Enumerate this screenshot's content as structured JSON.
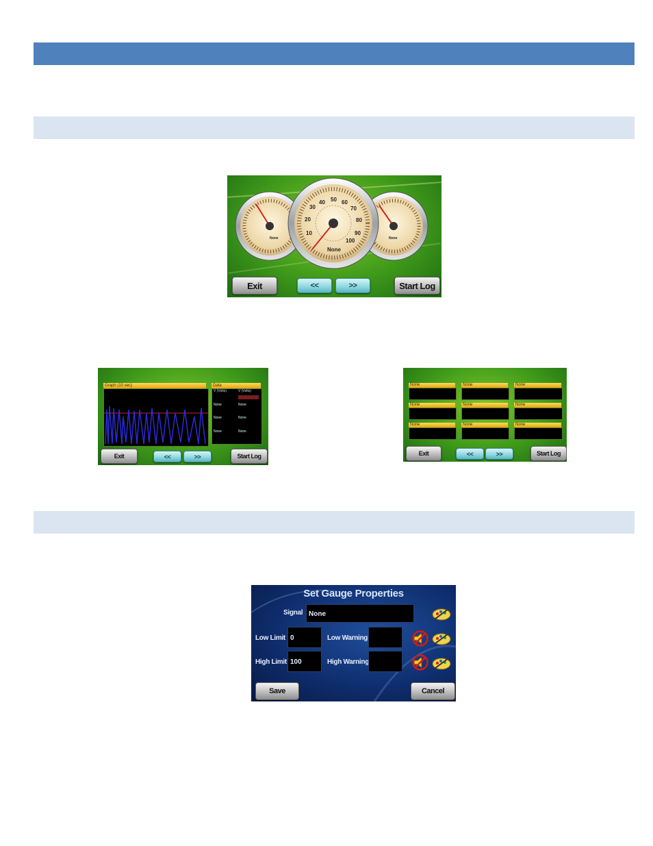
{
  "gauge_screen": {
    "left_gauge_label": "None",
    "center_gauge_ticks": [
      "10",
      "20",
      "30",
      "40",
      "50",
      "60",
      "70",
      "80",
      "90",
      "100"
    ],
    "center_gauge_label": "None",
    "right_gauge_label": "None",
    "buttons": {
      "exit": "Exit",
      "prev": "<<",
      "next": ">>",
      "start_log": "Start Log"
    }
  },
  "graph_screen": {
    "graph_title": "Graph (10 sec)",
    "data_title": "Data",
    "data_header_1": "V (Volts)",
    "data_header_2": "V (Volts)",
    "data_rows": [
      [
        "",
        ""
      ],
      [
        "None",
        "None"
      ],
      [
        "None",
        "None"
      ],
      [
        "None",
        "None"
      ]
    ],
    "buttons": {
      "exit": "Exit",
      "prev": "<<",
      "next": ">>",
      "start_log": "Start Log"
    }
  },
  "grid_screen": {
    "cells": [
      "None",
      "None",
      "None",
      "None",
      "None",
      "None",
      "None",
      "None",
      "None"
    ],
    "buttons": {
      "exit": "Exit",
      "prev": "<<",
      "next": ">>",
      "start_log": "Start Log"
    }
  },
  "properties_dialog": {
    "title": "Set Gauge Properties",
    "signal_label": "Signal",
    "signal_value": "None",
    "low_limit_label": "Low Limit",
    "low_limit_value": "0",
    "high_limit_label": "High Limit",
    "high_limit_value": "100",
    "low_warning_label": "Low Warning",
    "low_warning_value": "",
    "high_warning_label": "High Warning",
    "high_warning_value": "",
    "save_label": "Save",
    "cancel_label": "Cancel"
  },
  "colors": {
    "header_bar": "#4f81bd",
    "section_bar": "#dbe5f1"
  }
}
